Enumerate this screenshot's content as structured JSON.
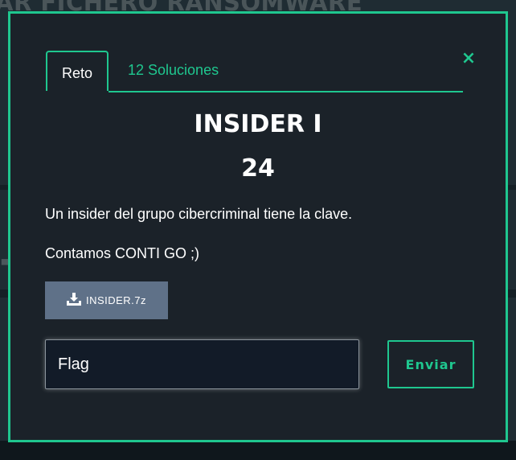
{
  "background": {
    "page_title": "AR FICHERO RANSOMWARE"
  },
  "modal": {
    "tabs": [
      {
        "label": "Reto"
      },
      {
        "label": "12 Soluciones"
      }
    ],
    "close_icon": "×",
    "challenge": {
      "name": "INSIDER I",
      "points": "24",
      "description_lines": [
        "Un insider del grupo cibercriminal tiene la clave.",
        "Contamos CONTI GO ;)"
      ],
      "file": {
        "icon": "download-icon",
        "name": "INSIDER.7z"
      }
    },
    "flag_input": {
      "placeholder": "Flag"
    },
    "submit_label": "Enviar"
  },
  "colors": {
    "accent": "#1fc78f",
    "modal_bg": "#1b2229",
    "download_bg": "#5f7188",
    "input_bg": "#121b28"
  }
}
